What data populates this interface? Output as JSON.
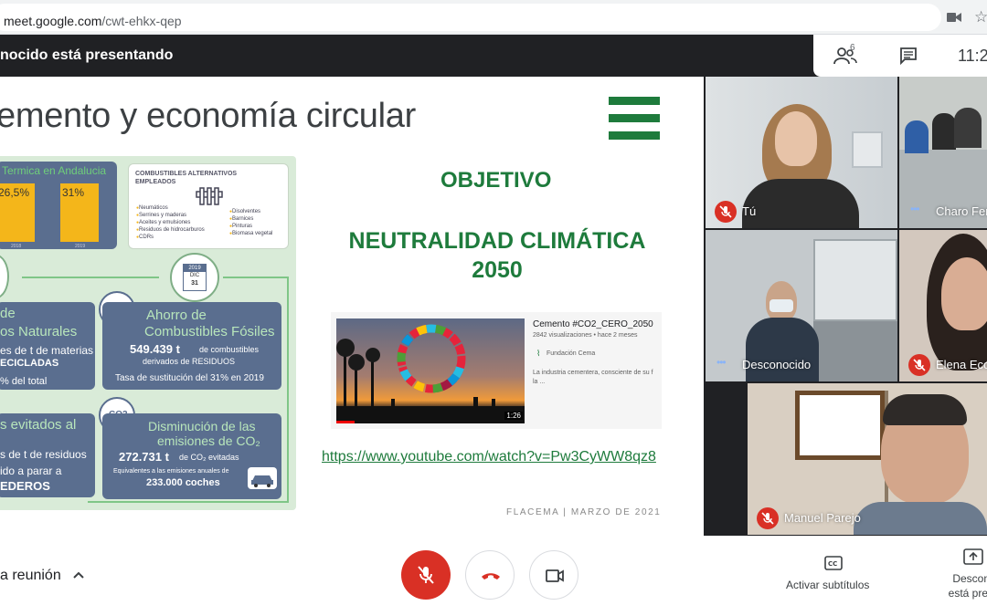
{
  "browser": {
    "url_host": "meet.google.com",
    "url_path": "/cwt-ehkx-qep"
  },
  "topbar": {
    "presenting_text": "nocido está presentando",
    "participants_count": "6",
    "time": "11:2"
  },
  "slide": {
    "title": "emento y economía circular",
    "objective_label": "OBJETIVO",
    "neutrality_line1": "NEUTRALIDAD CLIMÁTICA",
    "neutrality_line2": "2050",
    "link": "https://www.youtube.com/watch?v=Pw3CyWW8qz8",
    "footer": "FLACEMA | MARZO DE 2021",
    "infographic": {
      "termica_label": "Termica en Andalucia",
      "bar1_value": "26,5%",
      "bar2_value": "31%",
      "year1": "2018",
      "year2": "2019",
      "combustibles_title": "COMBUSTIBLES ALTERNATIVOS EMPLEADOS",
      "combustibles_col1": [
        "Neumáticos",
        "Serrines y maderas",
        "Aceites y emulsiones",
        "Residuos de hidrocarburos",
        "CDRs"
      ],
      "combustibles_col2": [
        "Disolventes",
        "Barnices",
        "Pinturas",
        "Biomasa vegetal"
      ],
      "calendar_year": "2019",
      "calendar_month": "DIC",
      "calendar_day": "31",
      "nat_title_a": "de",
      "nat_title_b": "os Naturales",
      "nat_line1": "es de t de materias",
      "nat_line2": "ECICLADAS",
      "nat_line3": "% del total",
      "ahorro_title1": "Ahorro de",
      "ahorro_title2": "Combustibles Fósiles",
      "ahorro_value": "549.439 t",
      "ahorro_unit": "de combustibles",
      "ahorro_sub": "derivados de RESIDUOS",
      "ahorro_rate": "Tasa de sustitución del 31% en 2019",
      "evit_title": "s evitados al",
      "evit_line1": "s de t de residuos",
      "evit_line2": "ido a parar a",
      "evit_line3": "EDEROS",
      "co2_badge": "CO2",
      "dism_title1": "Disminución de las",
      "dism_title2": "emisiones de CO₂",
      "dism_value": "272.731 t",
      "dism_unit": "de CO₂ evitadas",
      "dism_sub1": "Equivalentes a las emisiones anuales de",
      "dism_sub2": "233.000 coches"
    },
    "video": {
      "title": "Cemento #CO2_CERO_2050",
      "meta": "2842 visualizaciones • hace 2 meses",
      "channel": "Fundación Cema",
      "description": "La industria cementera, consciente de su f la ...",
      "duration": "1:26"
    }
  },
  "participants": [
    {
      "name": "Tú",
      "muted": true
    },
    {
      "name": "Charo Fer",
      "muted": false
    },
    {
      "name": "Desconocido",
      "muted": false
    },
    {
      "name": "Elena Eco",
      "muted": true
    },
    {
      "name": "Manuel Parejo",
      "muted": true
    }
  ],
  "bottombar": {
    "meeting_label": "a reunión",
    "captions_label": "Activar subtítulos",
    "presenter_line1": "Desconoc",
    "presenter_line2": "está presen"
  },
  "colors": {
    "meet_dark": "#202124",
    "mute_red": "#d93025",
    "slide_green": "#1e7b3c"
  }
}
